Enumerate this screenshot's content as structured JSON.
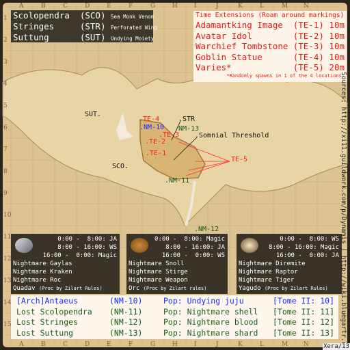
{
  "legend": [
    {
      "name": "Scolopendra",
      "code": "(SCO)",
      "drop": "Sea Monk Venom"
    },
    {
      "name": "Stringes",
      "code": "(STR)",
      "drop": "Perforated Wing"
    },
    {
      "name": "Suttung",
      "code": "(SUT)",
      "drop": "Undying Moiety"
    }
  ],
  "time_extensions": {
    "title": "Time Extensions (Roam around markings)",
    "items": [
      {
        "name": "Adamantking Image",
        "code": "(TE-1)",
        "time": "10m"
      },
      {
        "name": "Avatar Idol",
        "code": "(TE-2)",
        "time": "10m"
      },
      {
        "name": "Warchief Tombstone",
        "code": "(TE-3)",
        "time": "10m"
      },
      {
        "name": "Goblin Statue",
        "code": "(TE-4)",
        "time": "10m"
      },
      {
        "name": "Varies*",
        "code": "(TE-5)",
        "time": "20m"
      }
    ],
    "note": "*Randomly spawns in 1 of the 4 locations."
  },
  "map_labels": {
    "sut": "SUT.",
    "sco": "SCO.",
    "str": ".STR",
    "somnial": ".Somnial Threshold",
    "te1": ".TE-1",
    "te2": ".TE-2",
    "te3": ".TE-3",
    "te4": ".TE-4",
    "te5": "TE-5",
    "nm10": ".NM-10",
    "nm11": ".NM-11",
    "nm12": ".NM-12",
    "nm13": ".NM-13"
  },
  "grid": {
    "cols": [
      "A",
      "B",
      "C",
      "D",
      "E",
      "F",
      "G",
      "H",
      "I",
      "J",
      "K",
      "L",
      "M",
      "N"
    ],
    "rows": [
      "1",
      "2",
      "3",
      "4",
      "5",
      "6",
      "7",
      "8",
      "9",
      "10",
      "11",
      "12",
      "13",
      "14",
      "15"
    ]
  },
  "panels": [
    {
      "icon": "silver-cloth-icon",
      "times": [
        "0:00 -  8:00: JA",
        "8:00 - 16:00: WS",
        "16:00 -  0:00: Magic"
      ],
      "mobs": [
        "Nightmare Gaylas",
        "Nightmare Kraken",
        "Nightmare Roc"
      ],
      "proc_name": "Quadav",
      "proc_note": "(Proc by Zilart Rules)"
    },
    {
      "icon": "bronze-coin-icon",
      "times": [
        "0:00 -  8:00: Magic",
        "8:00 - 16:00: JA",
        "16:00 -  0:00: WS"
      ],
      "mobs": [
        "Nightmare Snoll",
        "Nightmare Stirge",
        "Nightmare Weapon"
      ],
      "proc_name": "Orc",
      "proc_note": "(Proc by Zilart rules)"
    },
    {
      "icon": "cowrie-shell-icon",
      "times": [
        "0:00 -  8:00: WS",
        "8:00 - 16:00: Magic",
        "16:00 -  0:00: JA"
      ],
      "mobs": [
        "Nightmare Diremite",
        "Nightmare Raptor",
        "Nightmare Tiger"
      ],
      "proc_name": "Yagudo",
      "proc_note": "(Proc by Zilart Rules)"
    }
  ],
  "nms": [
    {
      "name": "[Arch]Antaeus",
      "code": "(NM-10)",
      "pop": "Pop: Undying juju",
      "tome": "[Tome II: 10]"
    },
    {
      "name": "Lost Scolopendra",
      "code": "(NM-11)",
      "pop": "Pop: Nightmare shell",
      "tome": "[Tome II: 11]"
    },
    {
      "name": "Lost Stringes",
      "code": "(NM-12)",
      "pop": "Pop: Nightmare blood",
      "tome": "[Tome II: 12]"
    },
    {
      "name": "Lost Suttung",
      "code": "(NM-13)",
      "pop": "Pop: Nightmare shard",
      "tome": "[Tome II: 13]"
    }
  ],
  "sources": "Sources: http://xi11.guildwork.com/p/Dynamis | http://wiki.bluegartr.com",
  "signature": "Xera/13",
  "colors": {
    "te": "#ff1a1a",
    "nm10": "#1a2aff",
    "nm": "#1a5a1a",
    "parchment": "#dcc391"
  }
}
